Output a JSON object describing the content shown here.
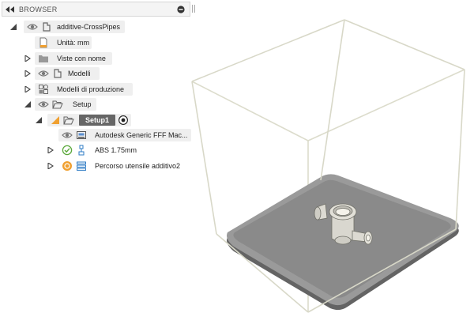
{
  "browser": {
    "title": "BROWSER",
    "collapse_icon": "double-left-triangle-icon",
    "pin_icon": "minus-circle-icon",
    "tree": {
      "root": {
        "label": "additive-CrossPipes",
        "icon": "component-icon"
      },
      "units": {
        "label": "Unità: mm",
        "icon": "document-icon"
      },
      "named_views": {
        "label": "Viste con nome",
        "icon": "folder-icon"
      },
      "models": {
        "label": "Modelli",
        "icon": "component-icon"
      },
      "production_models": {
        "label": "Modelli di produzione",
        "icon": "production-models-icon"
      },
      "setup_folder": {
        "label": "Setup",
        "icon": "open-folder-icon"
      },
      "setup1": {
        "label": "Setup1",
        "icon": "open-folder-icon",
        "active_icon": "target-circle-icon",
        "warning_icon": "warning-triangle-icon"
      },
      "machine": {
        "label": "Autodesk Generic FFF Mac...",
        "icon": "printer-machine-icon"
      },
      "material": {
        "label": "ABS 1.75mm",
        "icon": "material-icon",
        "status_icon": "check-circle-icon"
      },
      "toolpath": {
        "label": "Percorso utensile additivo2",
        "icon": "toolpath-icon",
        "status_icon": "toolpath-status-icon"
      }
    }
  },
  "colors": {
    "accent_orange": "#f0a030",
    "ok_green": "#5aa83a",
    "selection_gray": "#666666",
    "build_plate": "#808080",
    "envelope_line": "#d8d8c8"
  }
}
